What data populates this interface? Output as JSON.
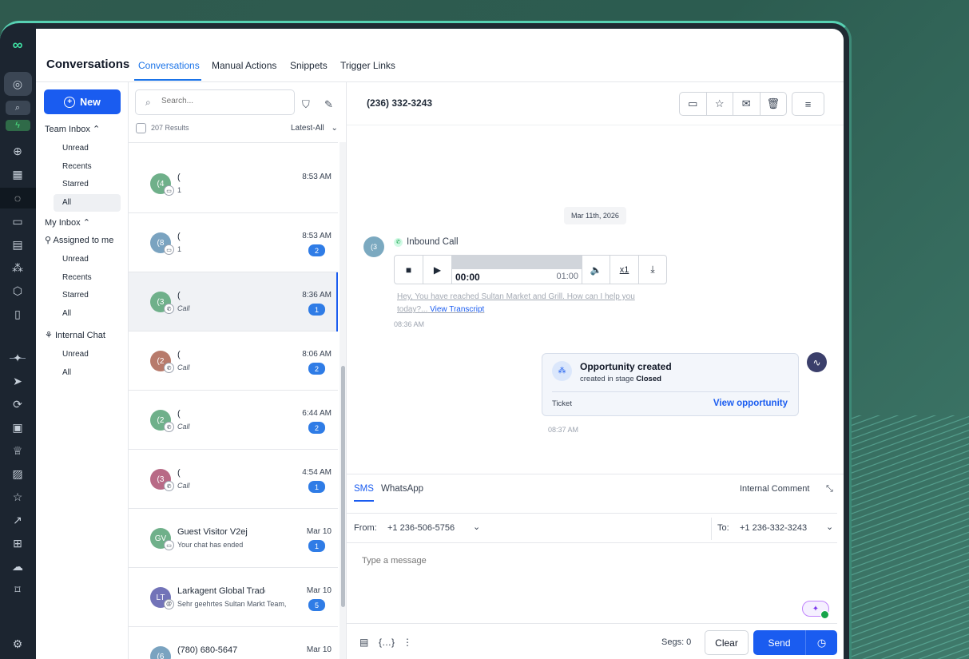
{
  "header": {
    "title": "Conversations",
    "tabs": [
      {
        "label": "Conversations",
        "active": true
      },
      {
        "label": "Manual Actions"
      },
      {
        "label": "Snippets"
      },
      {
        "label": "Trigger Links"
      }
    ]
  },
  "leftnav": {
    "new_label": "New",
    "team_inbox": "Team Inbox",
    "team_items": [
      "Unread",
      "Recents",
      "Starred",
      "All"
    ],
    "my_inbox": "My Inbox",
    "assigned": "Assigned to me",
    "my_items": [
      "Unread",
      "Recents",
      "Starred",
      "All"
    ],
    "internal_chat": "Internal Chat",
    "chat_items": [
      "Unread",
      "All"
    ]
  },
  "list": {
    "search_placeholder": "Search...",
    "results": "207 Results",
    "sort": "Latest-All",
    "rows": [
      {
        "initials": "(4",
        "name": "(",
        "preview": "1",
        "time": "8:53 AM",
        "count": "",
        "color": "#6fb08a",
        "badge": "msg"
      },
      {
        "initials": "(8",
        "name": "(",
        "preview": "1",
        "time": "8:53 AM",
        "count": "2",
        "color": "#7aa3c0",
        "badge": "msg"
      },
      {
        "initials": "(3",
        "name": "(",
        "preview": "Call",
        "time": "8:36 AM",
        "count": "1",
        "color": "#6fb08a",
        "badge": "call"
      },
      {
        "initials": "(2",
        "name": "(",
        "preview": "Call",
        "time": "8:06 AM",
        "count": "2",
        "color": "#b77a6b",
        "badge": "call"
      },
      {
        "initials": "(2",
        "name": "(",
        "preview": "Call",
        "time": "6:44 AM",
        "count": "2",
        "color": "#6fb08a",
        "badge": "call"
      },
      {
        "initials": "(3",
        "name": "(",
        "preview": "Call",
        "time": "4:54 AM",
        "count": "1",
        "color": "#b86a86",
        "badge": "call"
      },
      {
        "initials": "GV",
        "name": "Guest Visitor V2ej",
        "preview": "Your chat has ended",
        "time": "Mar 10",
        "count": "1",
        "color": "#6fb08a",
        "badge": "chat"
      },
      {
        "initials": "LT",
        "name": "Larkagent Global Trade",
        "preview": "Sehr geehrtes Sultan Markt Team,",
        "time": "Mar 10",
        "count": "5",
        "color": "#7273b8",
        "badge": "email"
      },
      {
        "initials": "(6",
        "name": "(780) 680-5647",
        "preview": "",
        "time": "Mar 10",
        "count": "",
        "color": "#7aa3c0",
        "badge": ""
      }
    ]
  },
  "chat": {
    "phone": "(236) 332-3243",
    "date": "Mar 11th, 2026",
    "caller_initials": "(3",
    "call_label": "Inbound Call",
    "player": {
      "current": "00:00",
      "duration": "01:00",
      "speed": "x1"
    },
    "transcript": "Hey, You have reached Sultan Market and Grill. How can I help you today?...",
    "transcript_link": "View Transcript",
    "call_time": "08:36 AM",
    "opportunity": {
      "title": "Opportunity created",
      "sub_prefix": "created in stage ",
      "stage": "Closed",
      "type": "Ticket",
      "link": "View opportunity",
      "time": "08:37 AM"
    }
  },
  "composer": {
    "tabs": [
      "SMS",
      "WhatsApp"
    ],
    "internal": "Internal Comment",
    "from_label": "From:",
    "from_value": "+1 236-506-5756",
    "to_label": "To:",
    "to_value": "+1 236-332-3243",
    "placeholder": "Type a message",
    "segs": "Segs: 0",
    "clear": "Clear",
    "send": "Send"
  }
}
